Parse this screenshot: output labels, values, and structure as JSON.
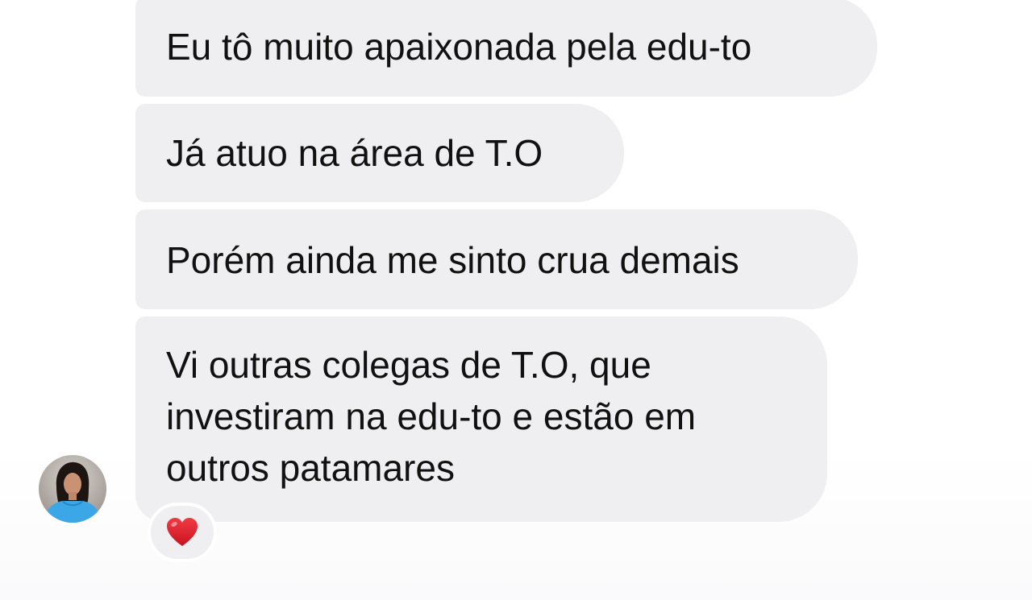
{
  "messages": [
    {
      "lines": [
        "Eu tô muito apaixonada pela edu-to"
      ]
    },
    {
      "lines": [
        "Já atuo na área de T.O"
      ]
    },
    {
      "lines": [
        "Porém ainda me sinto crua demais"
      ]
    },
    {
      "lines": [
        "Vi outras colegas de T.O, que",
        "investiram na edu-to e estão em",
        "outros patamares"
      ]
    }
  ],
  "reaction": {
    "icon": "red-heart-icon",
    "color": "#e0202a"
  },
  "colors": {
    "bubble": "#efeff1",
    "text": "#111111",
    "background": "#ffffff"
  }
}
